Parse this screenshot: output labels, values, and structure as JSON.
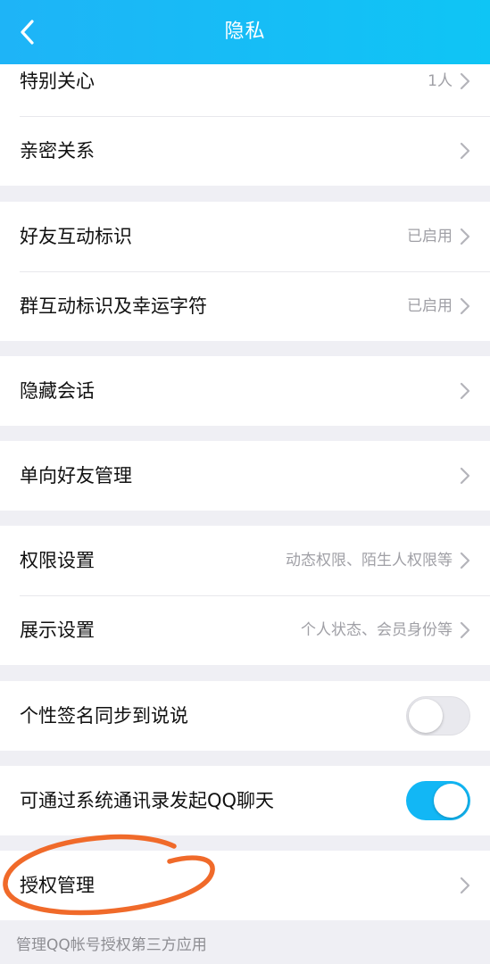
{
  "header": {
    "title": "隐私",
    "background": "#1EB4F7"
  },
  "groups": [
    {
      "rows": [
        {
          "label": "特别关心",
          "value": "1人"
        },
        {
          "label": "亲密关系",
          "value": ""
        }
      ]
    },
    {
      "rows": [
        {
          "label": "好友互动标识",
          "value": "已启用"
        },
        {
          "label": "群互动标识及幸运字符",
          "value": "已启用"
        }
      ]
    },
    {
      "rows": [
        {
          "label": "隐藏会话",
          "value": ""
        }
      ]
    },
    {
      "rows": [
        {
          "label": "单向好友管理",
          "value": ""
        }
      ]
    },
    {
      "rows": [
        {
          "label": "权限设置",
          "value": "动态权限、陌生人权限等"
        },
        {
          "label": "展示设置",
          "value": "个人状态、会员身份等"
        }
      ]
    },
    {
      "rows": [
        {
          "label": "个性签名同步到说说",
          "toggle": false
        }
      ]
    },
    {
      "rows": [
        {
          "label": "可通过系统通讯录发起QQ聊天",
          "toggle": true
        }
      ]
    },
    {
      "rows": [
        {
          "label": "授权管理",
          "value": ""
        }
      ]
    }
  ],
  "footnote": "管理QQ帐号授权第三方应用",
  "colors": {
    "accent": "#12B7F5",
    "annotation": "#F06A2A",
    "background": "#EFEFF4"
  }
}
